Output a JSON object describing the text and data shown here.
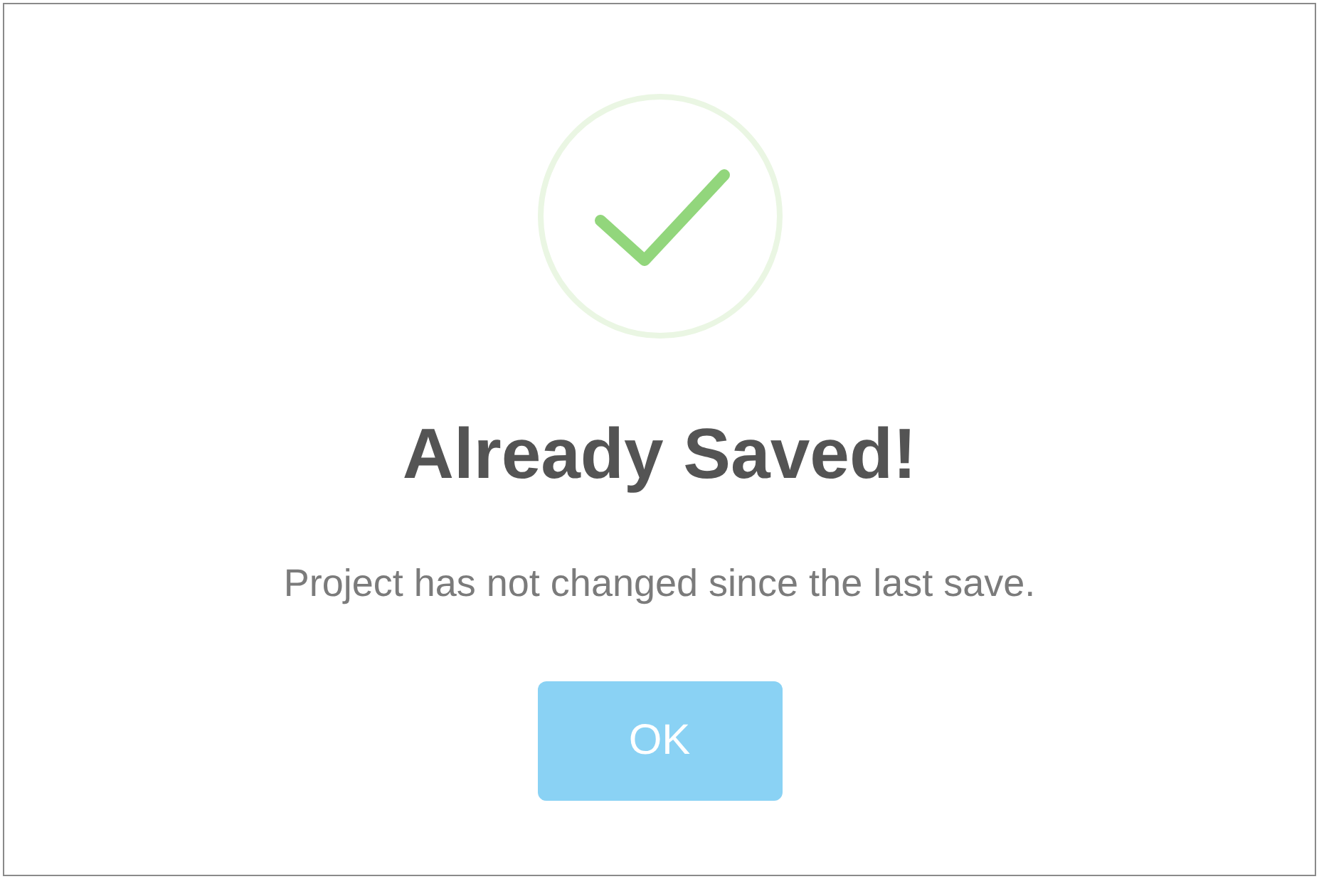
{
  "dialog": {
    "title": "Already Saved!",
    "message": "Project has not changed since the last save.",
    "buttons": [
      "OK"
    ]
  }
}
